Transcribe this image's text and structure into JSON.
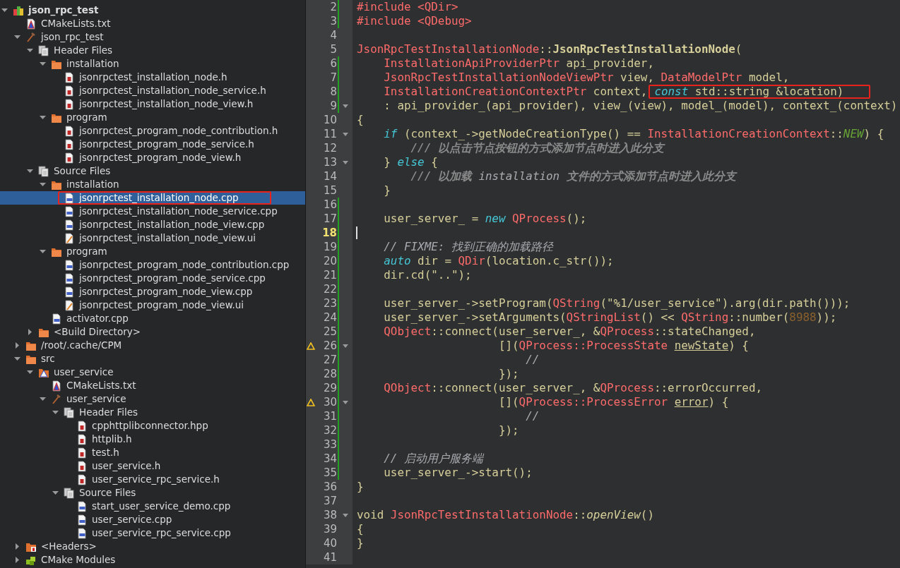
{
  "project_tree": {
    "items": [
      {
        "label": "json_rpc_test",
        "kind": "project",
        "expanded": true,
        "selected": false,
        "annotated": false,
        "children": [
          {
            "label": "CMakeLists.txt",
            "kind": "cmake",
            "selected": false,
            "annotated": false
          },
          {
            "label": "json_rpc_test",
            "kind": "target",
            "expanded": true,
            "selected": false,
            "annotated": false,
            "children": [
              {
                "label": "Header Files",
                "kind": "group",
                "expanded": true,
                "selected": false,
                "annotated": false,
                "children": [
                  {
                    "label": "installation",
                    "kind": "folder",
                    "expanded": true,
                    "selected": false,
                    "annotated": false,
                    "children": [
                      {
                        "label": "jsonrpctest_installation_node.h",
                        "kind": "header",
                        "selected": false,
                        "annotated": false
                      },
                      {
                        "label": "jsonrpctest_installation_node_service.h",
                        "kind": "header",
                        "selected": false,
                        "annotated": false
                      },
                      {
                        "label": "jsonrpctest_installation_node_view.h",
                        "kind": "header",
                        "selected": false,
                        "annotated": false
                      }
                    ]
                  },
                  {
                    "label": "program",
                    "kind": "folder",
                    "expanded": true,
                    "selected": false,
                    "annotated": false,
                    "children": [
                      {
                        "label": "jsonrpctest_program_node_contribution.h",
                        "kind": "header",
                        "selected": false,
                        "annotated": false
                      },
                      {
                        "label": "jsonrpctest_program_node_service.h",
                        "kind": "header",
                        "selected": false,
                        "annotated": false
                      },
                      {
                        "label": "jsonrpctest_program_node_view.h",
                        "kind": "header",
                        "selected": false,
                        "annotated": false
                      }
                    ]
                  }
                ]
              },
              {
                "label": "Source Files",
                "kind": "group",
                "expanded": true,
                "selected": false,
                "annotated": false,
                "children": [
                  {
                    "label": "installation",
                    "kind": "folder",
                    "expanded": true,
                    "selected": false,
                    "annotated": false,
                    "children": [
                      {
                        "label": "jsonrpctest_installation_node.cpp",
                        "kind": "source",
                        "selected": true,
                        "annotated": true
                      },
                      {
                        "label": "jsonrpctest_installation_node_service.cpp",
                        "kind": "source",
                        "selected": false,
                        "annotated": false
                      },
                      {
                        "label": "jsonrpctest_installation_node_view.cpp",
                        "kind": "source",
                        "selected": false,
                        "annotated": false
                      },
                      {
                        "label": "jsonrpctest_installation_node_view.ui",
                        "kind": "ui",
                        "selected": false,
                        "annotated": false
                      }
                    ]
                  },
                  {
                    "label": "program",
                    "kind": "folder",
                    "expanded": true,
                    "selected": false,
                    "annotated": false,
                    "children": [
                      {
                        "label": "jsonrpctest_program_node_contribution.cpp",
                        "kind": "source",
                        "selected": false,
                        "annotated": false
                      },
                      {
                        "label": "jsonrpctest_program_node_service.cpp",
                        "kind": "source",
                        "selected": false,
                        "annotated": false
                      },
                      {
                        "label": "jsonrpctest_program_node_view.cpp",
                        "kind": "source",
                        "selected": false,
                        "annotated": false
                      },
                      {
                        "label": "jsonrpctest_program_node_view.ui",
                        "kind": "ui",
                        "selected": false,
                        "annotated": false
                      }
                    ]
                  },
                  {
                    "label": "activator.cpp",
                    "kind": "source",
                    "selected": false,
                    "annotated": false
                  }
                ]
              },
              {
                "label": "<Build Directory>",
                "kind": "folder",
                "expanded": false,
                "selected": false,
                "annotated": false
              }
            ]
          },
          {
            "label": "/root/.cache/CPM",
            "kind": "folder",
            "expanded": false,
            "selected": false,
            "annotated": false
          },
          {
            "label": "src",
            "kind": "folder",
            "expanded": true,
            "selected": false,
            "annotated": false,
            "children": [
              {
                "label": "user_service",
                "kind": "cmake_folder",
                "expanded": true,
                "selected": false,
                "annotated": false,
                "children": [
                  {
                    "label": "CMakeLists.txt",
                    "kind": "cmake",
                    "selected": false,
                    "annotated": false
                  },
                  {
                    "label": "user_service",
                    "kind": "target",
                    "expanded": true,
                    "selected": false,
                    "annotated": false,
                    "children": [
                      {
                        "label": "Header Files",
                        "kind": "group",
                        "expanded": true,
                        "selected": false,
                        "annotated": false,
                        "children": [
                          {
                            "label": "cpphttplibconnector.hpp",
                            "kind": "header",
                            "selected": false,
                            "annotated": false
                          },
                          {
                            "label": "httplib.h",
                            "kind": "header",
                            "selected": false,
                            "annotated": false
                          },
                          {
                            "label": "test.h",
                            "kind": "header",
                            "selected": false,
                            "annotated": false
                          },
                          {
                            "label": "user_service.h",
                            "kind": "header",
                            "selected": false,
                            "annotated": false
                          },
                          {
                            "label": "user_service_rpc_service.h",
                            "kind": "header",
                            "selected": false,
                            "annotated": false
                          }
                        ]
                      },
                      {
                        "label": "Source Files",
                        "kind": "group",
                        "expanded": true,
                        "selected": false,
                        "annotated": false,
                        "children": [
                          {
                            "label": "start_user_service_demo.cpp",
                            "kind": "source",
                            "selected": false,
                            "annotated": false
                          },
                          {
                            "label": "user_service.cpp",
                            "kind": "source",
                            "selected": false,
                            "annotated": false
                          },
                          {
                            "label": "user_service_rpc_service.cpp",
                            "kind": "source",
                            "selected": false,
                            "annotated": false
                          }
                        ]
                      }
                    ]
                  }
                ]
              }
            ]
          },
          {
            "label": "<Headers>",
            "kind": "headers_folder",
            "expanded": false,
            "selected": false,
            "annotated": false
          },
          {
            "label": "CMake Modules",
            "kind": "modules",
            "expanded": false,
            "selected": false,
            "annotated": false
          }
        ]
      }
    ]
  },
  "editor": {
    "lines": [
      {
        "number": "2",
        "changed": true,
        "foldable": false,
        "warning": false,
        "current": false,
        "tokens": [
          {
            "kind": "preproc",
            "text": "#include"
          },
          {
            "kind": "type",
            "text": " <QDir>"
          }
        ]
      },
      {
        "number": "3",
        "changed": true,
        "foldable": false,
        "warning": false,
        "current": false,
        "tokens": [
          {
            "kind": "preproc",
            "text": "#include"
          },
          {
            "kind": "type",
            "text": " <QDebug>"
          }
        ]
      },
      {
        "number": "4",
        "changed": false,
        "foldable": false,
        "warning": false,
        "current": false
      },
      {
        "number": "5",
        "changed": false,
        "foldable": false,
        "warning": false,
        "current": false,
        "tokens": [
          {
            "kind": "type",
            "text": "JsonRpcTestInstallationNode"
          },
          {
            "kind": "plain",
            "text": "::"
          },
          {
            "kind": "bold",
            "text": "JsonRpcTestInstallationNode"
          },
          {
            "kind": "plain",
            "text": "("
          }
        ]
      },
      {
        "number": "6",
        "changed": true,
        "foldable": false,
        "warning": false,
        "current": false,
        "tokens": [
          {
            "kind": "type",
            "text": "    InstallationApiProviderPtr"
          },
          {
            "kind": "plain",
            "text": " api_provider,"
          }
        ]
      },
      {
        "number": "7",
        "changed": true,
        "foldable": false,
        "warning": false,
        "current": false,
        "tokens": [
          {
            "kind": "type",
            "text": "    JsonRpcTestInstallationNodeViewPtr"
          },
          {
            "kind": "plain",
            "text": " view,"
          },
          {
            "kind": "type",
            "text": " DataModelPtr"
          },
          {
            "kind": "plain",
            "text": " model,"
          }
        ]
      },
      {
        "number": "8",
        "changed": true,
        "foldable": false,
        "warning": false,
        "current": false,
        "tokens": [
          {
            "kind": "type",
            "text": "    InstallationCreationContextPtr"
          },
          {
            "kind": "plain",
            "text": " context,"
          },
          {
            "kind": "keyword",
            "text": "const",
            "boxed": true
          },
          {
            "kind": "plain",
            "text": " std::string &location)",
            "boxed": true
          }
        ]
      },
      {
        "number": "9",
        "changed": true,
        "foldable": true,
        "warning": false,
        "current": false,
        "tokens": [
          {
            "kind": "plain",
            "text": "    : api_provider_(api_provider), view_(view), model_(model), context_(context)"
          }
        ]
      },
      {
        "number": "10",
        "changed": false,
        "foldable": false,
        "warning": false,
        "current": false,
        "tokens": [
          {
            "kind": "plain",
            "text": "{"
          }
        ]
      },
      {
        "number": "11",
        "changed": false,
        "foldable": true,
        "warning": false,
        "current": false,
        "tokens": [
          {
            "kind": "keyword",
            "text": "    if"
          },
          {
            "kind": "plain",
            "text": " (context_->getNodeCreationType() == "
          },
          {
            "kind": "type",
            "text": "InstallationCreationContext"
          },
          {
            "kind": "plain",
            "text": "::"
          },
          {
            "kind": "enum",
            "text": "NEW"
          },
          {
            "kind": "plain",
            "text": ") {"
          }
        ]
      },
      {
        "number": "12",
        "changed": false,
        "foldable": false,
        "warning": false,
        "current": false,
        "tokens": [
          {
            "kind": "doc",
            "text": "        /// 以点击节点按钮的方式添加节点时进入此分支"
          }
        ]
      },
      {
        "number": "13",
        "changed": false,
        "foldable": true,
        "warning": false,
        "current": false,
        "tokens": [
          {
            "kind": "plain",
            "text": "    } "
          },
          {
            "kind": "keyword",
            "text": "else"
          },
          {
            "kind": "plain",
            "text": " {"
          }
        ]
      },
      {
        "number": "14",
        "changed": false,
        "foldable": false,
        "warning": false,
        "current": false,
        "tokens": [
          {
            "kind": "doc",
            "text": "        /// 以加载"
          },
          {
            "kind": "comment",
            "text": " installation "
          },
          {
            "kind": "doc",
            "text": "文件的方式添加节点时进入此分支"
          }
        ]
      },
      {
        "number": "15",
        "changed": false,
        "foldable": false,
        "warning": false,
        "current": false,
        "tokens": [
          {
            "kind": "plain",
            "text": "    }"
          }
        ]
      },
      {
        "number": "16",
        "changed": true,
        "foldable": false,
        "warning": false,
        "current": false
      },
      {
        "number": "17",
        "changed": true,
        "foldable": false,
        "warning": false,
        "current": false,
        "tokens": [
          {
            "kind": "plain",
            "text": "    user_server_ = "
          },
          {
            "kind": "keyword",
            "text": "new"
          },
          {
            "kind": "type",
            "text": " QProcess"
          },
          {
            "kind": "plain",
            "text": "();"
          }
        ]
      },
      {
        "number": "18",
        "changed": true,
        "foldable": false,
        "warning": false,
        "current": true
      },
      {
        "number": "19",
        "changed": true,
        "foldable": false,
        "warning": false,
        "current": false,
        "tokens": [
          {
            "kind": "comment",
            "text": "    // FIXME: 找到正确的加载路径"
          }
        ]
      },
      {
        "number": "20",
        "changed": true,
        "foldable": false,
        "warning": false,
        "current": false,
        "tokens": [
          {
            "kind": "keyword",
            "text": "    auto"
          },
          {
            "kind": "plain",
            "text": " dir = "
          },
          {
            "kind": "type",
            "text": "QDir"
          },
          {
            "kind": "plain",
            "text": "(location.c_str());"
          }
        ]
      },
      {
        "number": "21",
        "changed": true,
        "foldable": false,
        "warning": false,
        "current": false,
        "tokens": [
          {
            "kind": "plain",
            "text": "    dir.cd(\"..\");"
          }
        ]
      },
      {
        "number": "22",
        "changed": true,
        "foldable": false,
        "warning": false,
        "current": false
      },
      {
        "number": "23",
        "changed": true,
        "foldable": false,
        "warning": false,
        "current": false,
        "tokens": [
          {
            "kind": "plain",
            "text": "    user_server_->setProgram("
          },
          {
            "kind": "type",
            "text": "QString"
          },
          {
            "kind": "plain",
            "text": "(\"%1/user_service\").arg(dir.path()));"
          }
        ]
      },
      {
        "number": "24",
        "changed": true,
        "foldable": false,
        "warning": false,
        "current": false,
        "tokens": [
          {
            "kind": "plain",
            "text": "    user_server_->setArguments("
          },
          {
            "kind": "type",
            "text": "QStringList"
          },
          {
            "kind": "plain",
            "text": "() << "
          },
          {
            "kind": "type",
            "text": "QString"
          },
          {
            "kind": "plain",
            "text": "::number("
          },
          {
            "kind": "number",
            "text": "8988"
          },
          {
            "kind": "plain",
            "text": "));"
          }
        ]
      },
      {
        "number": "25",
        "changed": true,
        "foldable": false,
        "warning": false,
        "current": false,
        "tokens": [
          {
            "kind": "type",
            "text": "    QObject"
          },
          {
            "kind": "plain",
            "text": "::connect(user_server_, &"
          },
          {
            "kind": "type",
            "text": "QProcess"
          },
          {
            "kind": "plain",
            "text": "::stateChanged,"
          }
        ]
      },
      {
        "number": "26",
        "changed": true,
        "foldable": true,
        "warning": true,
        "current": false,
        "tokens": [
          {
            "kind": "plain",
            "text": "                     []("
          },
          {
            "kind": "type",
            "text": "QProcess::ProcessState "
          },
          {
            "kind": "warn",
            "text": "newState"
          },
          {
            "kind": "plain",
            "text": ") {"
          }
        ]
      },
      {
        "number": "27",
        "changed": true,
        "foldable": false,
        "warning": false,
        "current": false,
        "tokens": [
          {
            "kind": "comment",
            "text": "                         //"
          }
        ]
      },
      {
        "number": "28",
        "changed": true,
        "foldable": false,
        "warning": false,
        "current": false,
        "tokens": [
          {
            "kind": "plain",
            "text": "                     });"
          }
        ]
      },
      {
        "number": "29",
        "changed": true,
        "foldable": false,
        "warning": false,
        "current": false,
        "tokens": [
          {
            "kind": "type",
            "text": "    QObject"
          },
          {
            "kind": "plain",
            "text": "::connect(user_server_, &"
          },
          {
            "kind": "type",
            "text": "QProcess"
          },
          {
            "kind": "plain",
            "text": "::errorOccurred,"
          }
        ]
      },
      {
        "number": "30",
        "changed": true,
        "foldable": true,
        "warning": true,
        "current": false,
        "tokens": [
          {
            "kind": "plain",
            "text": "                     []("
          },
          {
            "kind": "type",
            "text": "QProcess::ProcessError "
          },
          {
            "kind": "warn",
            "text": "error"
          },
          {
            "kind": "plain",
            "text": ") {"
          }
        ]
      },
      {
        "number": "31",
        "changed": true,
        "foldable": false,
        "warning": false,
        "current": false,
        "tokens": [
          {
            "kind": "comment",
            "text": "                         //"
          }
        ]
      },
      {
        "number": "32",
        "changed": true,
        "foldable": false,
        "warning": false,
        "current": false,
        "tokens": [
          {
            "kind": "plain",
            "text": "                     });"
          }
        ]
      },
      {
        "number": "33",
        "changed": true,
        "foldable": false,
        "warning": false,
        "current": false
      },
      {
        "number": "34",
        "changed": true,
        "foldable": false,
        "warning": false,
        "current": false,
        "tokens": [
          {
            "kind": "comment",
            "text": "    // 启动用户服务端"
          }
        ]
      },
      {
        "number": "35",
        "changed": true,
        "foldable": false,
        "warning": false,
        "current": false,
        "tokens": [
          {
            "kind": "plain",
            "text": "    user_server_->start();"
          }
        ]
      },
      {
        "number": "36",
        "changed": false,
        "foldable": false,
        "warning": false,
        "current": false,
        "tokens": [
          {
            "kind": "plain",
            "text": "}"
          }
        ]
      },
      {
        "number": "37",
        "changed": false,
        "foldable": false,
        "warning": false,
        "current": false
      },
      {
        "number": "38",
        "changed": false,
        "foldable": true,
        "warning": false,
        "current": false,
        "tokens": [
          {
            "kind": "plain",
            "text": "void "
          },
          {
            "kind": "type",
            "text": "JsonRpcTestInstallationNode"
          },
          {
            "kind": "plain",
            "text": "::"
          },
          {
            "kind": "italic",
            "text": "openView"
          },
          {
            "kind": "plain",
            "text": "()"
          }
        ]
      },
      {
        "number": "39",
        "changed": false,
        "foldable": false,
        "warning": false,
        "current": false,
        "tokens": [
          {
            "kind": "plain",
            "text": "{"
          }
        ]
      },
      {
        "number": "40",
        "changed": false,
        "foldable": false,
        "warning": false,
        "current": false,
        "tokens": [
          {
            "kind": "plain",
            "text": "}"
          }
        ]
      },
      {
        "number": "41",
        "changed": false,
        "foldable": false,
        "warning": false,
        "current": false
      }
    ]
  }
}
